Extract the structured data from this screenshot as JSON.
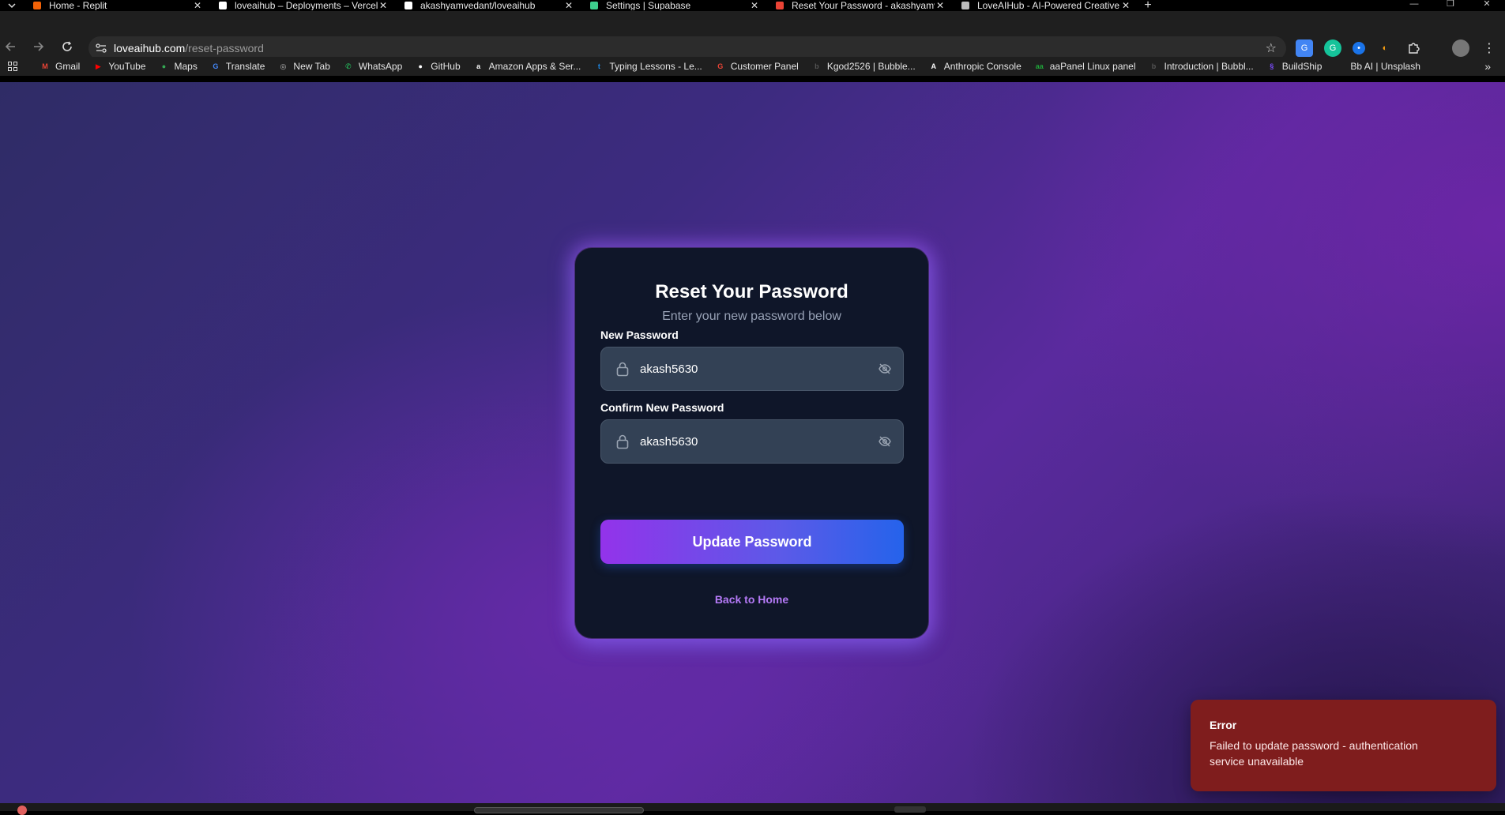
{
  "tabs": [
    {
      "label": "Home - Replit",
      "icon": "replit-icon",
      "color": "#f26207"
    },
    {
      "label": "loveaihub – Deployments – Vercel",
      "icon": "vercel-icon",
      "color": "#ffffff"
    },
    {
      "label": "akashyamvedant/loveaihub",
      "icon": "github-icon",
      "color": "#ffffff"
    },
    {
      "label": "Settings | Supabase",
      "icon": "supabase-icon",
      "color": "#3ecf8e"
    },
    {
      "label": "Reset Your Password - akashyamvedant",
      "icon": "gmail-icon",
      "color": "#ea4335"
    },
    {
      "label": "LoveAIHub - AI-Powered Creative",
      "icon": "globe-icon",
      "color": "#bbbbbb"
    }
  ],
  "address_bar": {
    "domain": "loveaihub.com",
    "path": "/reset-password"
  },
  "bookmarks": [
    {
      "label": "Gmail",
      "icon": "gmail-icon",
      "color": "#ea4335",
      "glyph": "M"
    },
    {
      "label": "YouTube",
      "icon": "youtube-icon",
      "color": "#ff0000",
      "glyph": "▶"
    },
    {
      "label": "Maps",
      "icon": "maps-icon",
      "color": "#34a853",
      "glyph": "●"
    },
    {
      "label": "Translate",
      "icon": "translate-icon",
      "color": "#4285f4",
      "glyph": "G"
    },
    {
      "label": "New Tab",
      "icon": "new-tab-icon",
      "color": "#bbbbbb",
      "glyph": "◎"
    },
    {
      "label": "WhatsApp",
      "icon": "whatsapp-icon",
      "color": "#25d366",
      "glyph": "✆"
    },
    {
      "label": "GitHub",
      "icon": "github-icon",
      "color": "#ffffff",
      "glyph": "●"
    },
    {
      "label": "Amazon Apps & Ser...",
      "icon": "amazon-icon",
      "color": "#ffffff",
      "glyph": "a"
    },
    {
      "label": "Typing Lessons - Le...",
      "icon": "typing-icon",
      "color": "#1e88e5",
      "glyph": "t"
    },
    {
      "label": "Customer Panel",
      "icon": "google-icon",
      "color": "#ea4335",
      "glyph": "G"
    },
    {
      "label": "Kgod2526 | Bubble...",
      "icon": "bubble-icon",
      "color": "#555555",
      "glyph": "b"
    },
    {
      "label": "Anthropic Console",
      "icon": "anthropic-icon",
      "color": "#ffffff",
      "glyph": "A"
    },
    {
      "label": "aaPanel Linux panel",
      "icon": "aapanel-icon",
      "color": "#20a53a",
      "glyph": "aa"
    },
    {
      "label": "Introduction | Bubbl...",
      "icon": "bubble-icon",
      "color": "#555555",
      "glyph": "b"
    },
    {
      "label": "BuildShip",
      "icon": "buildship-icon",
      "color": "#7c4dff",
      "glyph": "§"
    },
    {
      "label": "Bb AI | Unsplash",
      "icon": "unsplash-icon",
      "color": "#1f1f1f",
      "glyph": ""
    }
  ],
  "form": {
    "title": "Reset Your Password",
    "subtitle": "Enter your new password below",
    "new_password_label": "New Password",
    "new_password_value": "akash5630",
    "confirm_password_label": "Confirm New Password",
    "confirm_password_value": "akash5630",
    "submit_label": "Update Password",
    "back_link": "Back to Home"
  },
  "toast": {
    "title": "Error",
    "message": "Failed to update password - authentication service unavailable",
    "color": "#7f1d1d"
  }
}
